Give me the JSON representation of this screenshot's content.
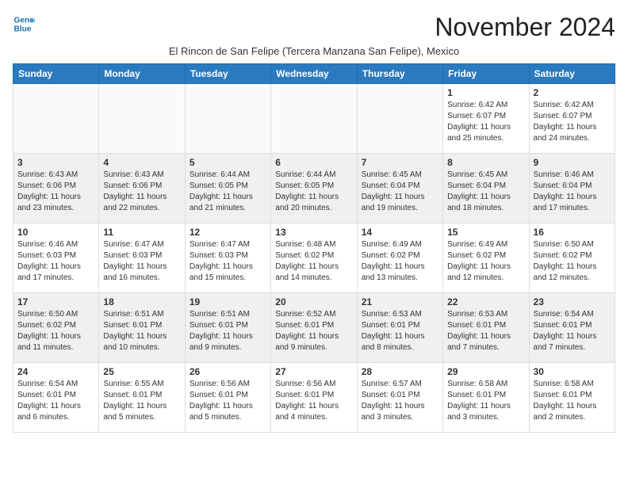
{
  "logo": {
    "line1": "General",
    "line2": "Blue"
  },
  "title": "November 2024",
  "subtitle": "El Rincon de San Felipe (Tercera Manzana San Felipe), Mexico",
  "days_header": [
    "Sunday",
    "Monday",
    "Tuesday",
    "Wednesday",
    "Thursday",
    "Friday",
    "Saturday"
  ],
  "weeks": [
    [
      {
        "day": "",
        "info": ""
      },
      {
        "day": "",
        "info": ""
      },
      {
        "day": "",
        "info": ""
      },
      {
        "day": "",
        "info": ""
      },
      {
        "day": "",
        "info": ""
      },
      {
        "day": "1",
        "info": "Sunrise: 6:42 AM\nSunset: 6:07 PM\nDaylight: 11 hours\nand 25 minutes."
      },
      {
        "day": "2",
        "info": "Sunrise: 6:42 AM\nSunset: 6:07 PM\nDaylight: 11 hours\nand 24 minutes."
      }
    ],
    [
      {
        "day": "3",
        "info": "Sunrise: 6:43 AM\nSunset: 6:06 PM\nDaylight: 11 hours\nand 23 minutes."
      },
      {
        "day": "4",
        "info": "Sunrise: 6:43 AM\nSunset: 6:06 PM\nDaylight: 11 hours\nand 22 minutes."
      },
      {
        "day": "5",
        "info": "Sunrise: 6:44 AM\nSunset: 6:05 PM\nDaylight: 11 hours\nand 21 minutes."
      },
      {
        "day": "6",
        "info": "Sunrise: 6:44 AM\nSunset: 6:05 PM\nDaylight: 11 hours\nand 20 minutes."
      },
      {
        "day": "7",
        "info": "Sunrise: 6:45 AM\nSunset: 6:04 PM\nDaylight: 11 hours\nand 19 minutes."
      },
      {
        "day": "8",
        "info": "Sunrise: 6:45 AM\nSunset: 6:04 PM\nDaylight: 11 hours\nand 18 minutes."
      },
      {
        "day": "9",
        "info": "Sunrise: 6:46 AM\nSunset: 6:04 PM\nDaylight: 11 hours\nand 17 minutes."
      }
    ],
    [
      {
        "day": "10",
        "info": "Sunrise: 6:46 AM\nSunset: 6:03 PM\nDaylight: 11 hours\nand 17 minutes."
      },
      {
        "day": "11",
        "info": "Sunrise: 6:47 AM\nSunset: 6:03 PM\nDaylight: 11 hours\nand 16 minutes."
      },
      {
        "day": "12",
        "info": "Sunrise: 6:47 AM\nSunset: 6:03 PM\nDaylight: 11 hours\nand 15 minutes."
      },
      {
        "day": "13",
        "info": "Sunrise: 6:48 AM\nSunset: 6:02 PM\nDaylight: 11 hours\nand 14 minutes."
      },
      {
        "day": "14",
        "info": "Sunrise: 6:49 AM\nSunset: 6:02 PM\nDaylight: 11 hours\nand 13 minutes."
      },
      {
        "day": "15",
        "info": "Sunrise: 6:49 AM\nSunset: 6:02 PM\nDaylight: 11 hours\nand 12 minutes."
      },
      {
        "day": "16",
        "info": "Sunrise: 6:50 AM\nSunset: 6:02 PM\nDaylight: 11 hours\nand 12 minutes."
      }
    ],
    [
      {
        "day": "17",
        "info": "Sunrise: 6:50 AM\nSunset: 6:02 PM\nDaylight: 11 hours\nand 11 minutes."
      },
      {
        "day": "18",
        "info": "Sunrise: 6:51 AM\nSunset: 6:01 PM\nDaylight: 11 hours\nand 10 minutes."
      },
      {
        "day": "19",
        "info": "Sunrise: 6:51 AM\nSunset: 6:01 PM\nDaylight: 11 hours\nand 9 minutes."
      },
      {
        "day": "20",
        "info": "Sunrise: 6:52 AM\nSunset: 6:01 PM\nDaylight: 11 hours\nand 9 minutes."
      },
      {
        "day": "21",
        "info": "Sunrise: 6:53 AM\nSunset: 6:01 PM\nDaylight: 11 hours\nand 8 minutes."
      },
      {
        "day": "22",
        "info": "Sunrise: 6:53 AM\nSunset: 6:01 PM\nDaylight: 11 hours\nand 7 minutes."
      },
      {
        "day": "23",
        "info": "Sunrise: 6:54 AM\nSunset: 6:01 PM\nDaylight: 11 hours\nand 7 minutes."
      }
    ],
    [
      {
        "day": "24",
        "info": "Sunrise: 6:54 AM\nSunset: 6:01 PM\nDaylight: 11 hours\nand 6 minutes."
      },
      {
        "day": "25",
        "info": "Sunrise: 6:55 AM\nSunset: 6:01 PM\nDaylight: 11 hours\nand 5 minutes."
      },
      {
        "day": "26",
        "info": "Sunrise: 6:56 AM\nSunset: 6:01 PM\nDaylight: 11 hours\nand 5 minutes."
      },
      {
        "day": "27",
        "info": "Sunrise: 6:56 AM\nSunset: 6:01 PM\nDaylight: 11 hours\nand 4 minutes."
      },
      {
        "day": "28",
        "info": "Sunrise: 6:57 AM\nSunset: 6:01 PM\nDaylight: 11 hours\nand 3 minutes."
      },
      {
        "day": "29",
        "info": "Sunrise: 6:58 AM\nSunset: 6:01 PM\nDaylight: 11 hours\nand 3 minutes."
      },
      {
        "day": "30",
        "info": "Sunrise: 6:58 AM\nSunset: 6:01 PM\nDaylight: 11 hours\nand 2 minutes."
      }
    ]
  ]
}
